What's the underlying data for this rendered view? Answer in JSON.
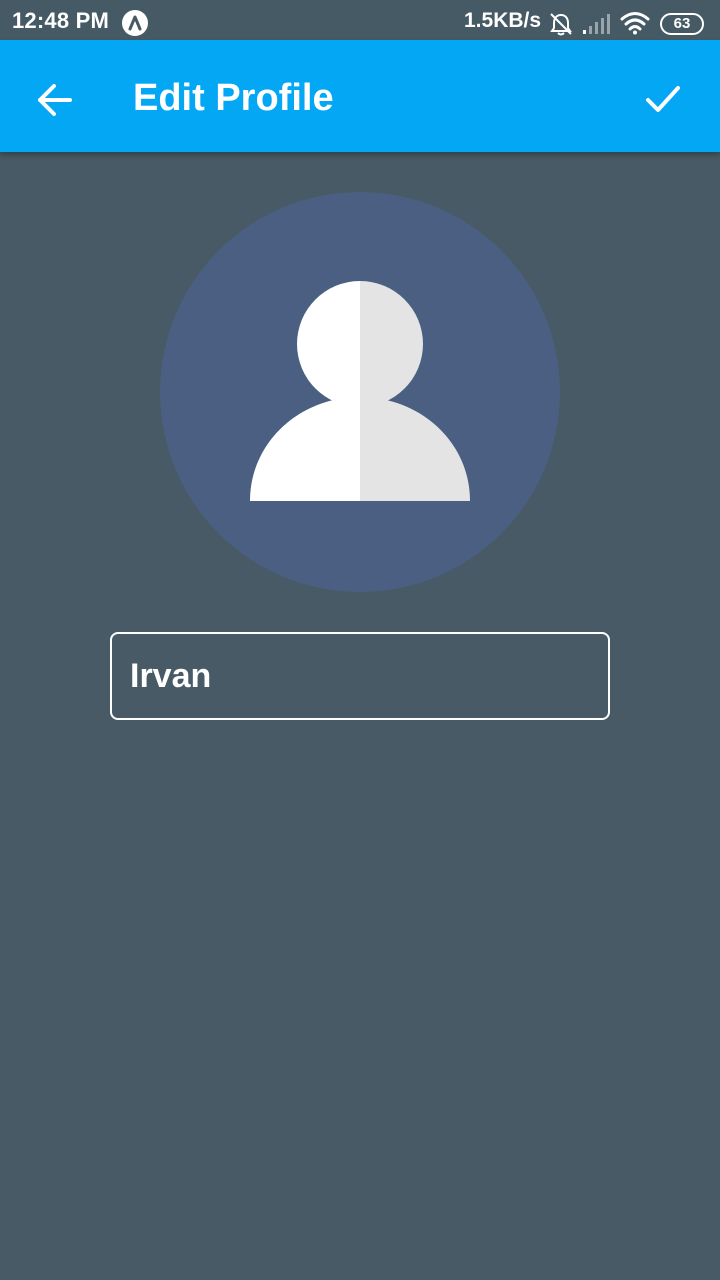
{
  "status_bar": {
    "time": "12:48 PM",
    "net_speed": "1.5KB/s",
    "battery_level": "63",
    "icons": [
      "app-badge-icon",
      "dnd-bell-off-icon",
      "signal-icon",
      "wifi-icon",
      "battery-icon"
    ]
  },
  "app_bar": {
    "title": "Edit Profile",
    "back_icon": "arrow-left-icon",
    "save_icon": "check-icon",
    "color": "#03a7f4"
  },
  "profile": {
    "avatar_icon": "person-placeholder-icon",
    "avatar_bg": "#4b5f83",
    "name_value": "Irvan"
  },
  "theme": {
    "background": "#475a65"
  }
}
